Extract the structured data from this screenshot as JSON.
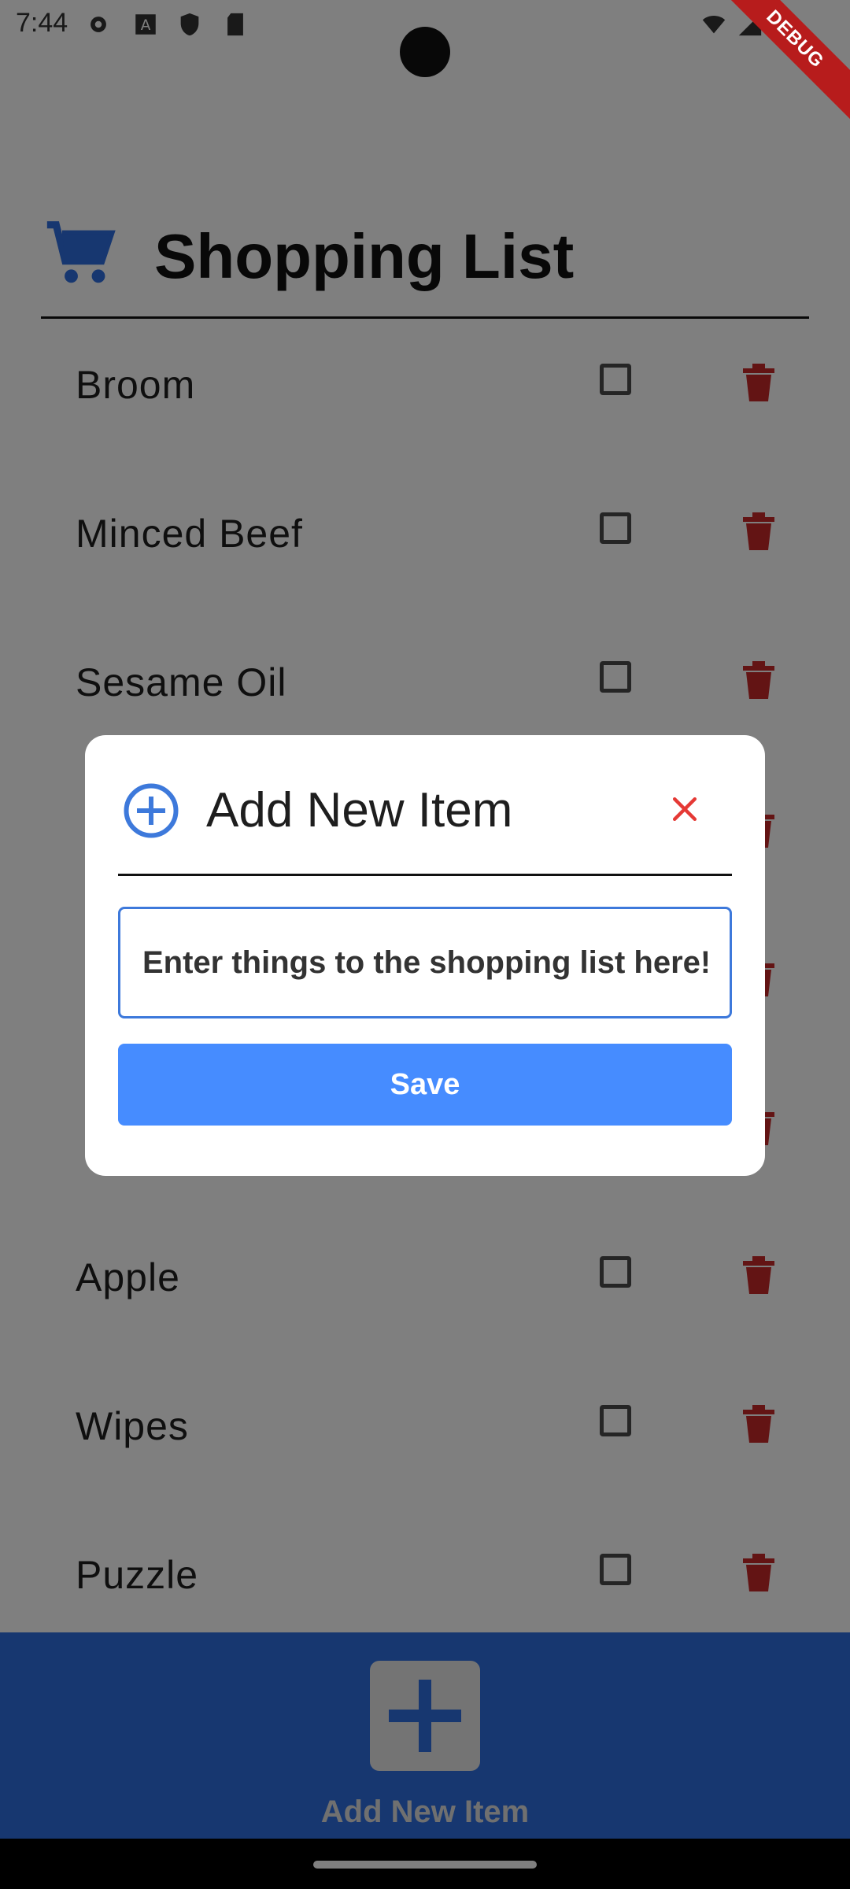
{
  "status_bar": {
    "time": "7:44",
    "debug_label": "DEBUG"
  },
  "app": {
    "title": "Shopping List"
  },
  "items": [
    {
      "label": "Broom"
    },
    {
      "label": "Minced Beef"
    },
    {
      "label": "Sesame Oil"
    },
    {
      "label": ""
    },
    {
      "label": ""
    },
    {
      "label": ""
    },
    {
      "label": "Apple"
    },
    {
      "label": "Wipes"
    },
    {
      "label": "Puzzle"
    }
  ],
  "bottom_bar": {
    "add_label": "Add New Item"
  },
  "dialog": {
    "title": "Add New Item",
    "input_placeholder": "Enter things to the shopping list here!",
    "save_label": "Save"
  },
  "colors": {
    "accent": "#2f6ee0",
    "danger": "#c62828",
    "button": "#468cff"
  }
}
